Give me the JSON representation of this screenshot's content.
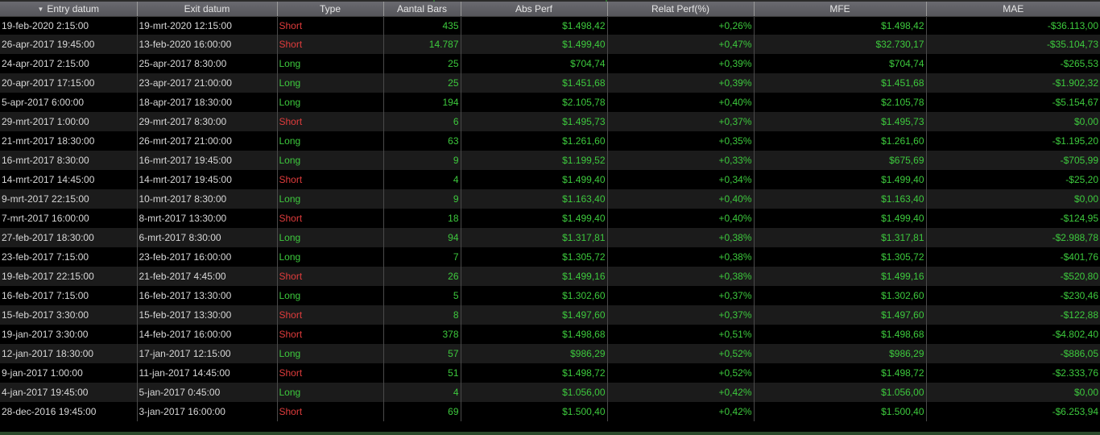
{
  "colors": {
    "header_bg": "#5f5f64",
    "row_dark": "#000000",
    "row_light": "#1b1b1b",
    "positive_green": "#3dc93d",
    "short_red": "#e03c3c",
    "text_light": "#d8d8d8"
  },
  "header": {
    "sort_icon": "sort-desc-icon",
    "columns": [
      "Entry datum",
      "Exit datum",
      "Type",
      "Aantal Bars",
      "Abs Perf",
      "Relat Perf(%)",
      "MFE",
      "MAE"
    ]
  },
  "rows": [
    {
      "entry": "19-feb-2020 2:15:00",
      "exit": "19-mrt-2020 12:15:00",
      "type": "Short",
      "bars": "435",
      "abs": "$1.498,42",
      "rel": "+0,26%",
      "mfe": "$1.498,42",
      "mae": "-$36.113,00"
    },
    {
      "entry": "26-apr-2017 19:45:00",
      "exit": "13-feb-2020 16:00:00",
      "type": "Short",
      "bars": "14.787",
      "abs": "$1.499,40",
      "rel": "+0,47%",
      "mfe": "$32.730,17",
      "mae": "-$35.104,73"
    },
    {
      "entry": "24-apr-2017 2:15:00",
      "exit": "25-apr-2017 8:30:00",
      "type": "Long",
      "bars": "25",
      "abs": "$704,74",
      "rel": "+0,39%",
      "mfe": "$704,74",
      "mae": "-$265,53"
    },
    {
      "entry": "20-apr-2017 17:15:00",
      "exit": "23-apr-2017 21:00:00",
      "type": "Long",
      "bars": "25",
      "abs": "$1.451,68",
      "rel": "+0,39%",
      "mfe": "$1.451,68",
      "mae": "-$1.902,32"
    },
    {
      "entry": "5-apr-2017 6:00:00",
      "exit": "18-apr-2017 18:30:00",
      "type": "Long",
      "bars": "194",
      "abs": "$2.105,78",
      "rel": "+0,40%",
      "mfe": "$2.105,78",
      "mae": "-$5.154,67"
    },
    {
      "entry": "29-mrt-2017 1:00:00",
      "exit": "29-mrt-2017 8:30:00",
      "type": "Short",
      "bars": "6",
      "abs": "$1.495,73",
      "rel": "+0,37%",
      "mfe": "$1.495,73",
      "mae": "$0,00"
    },
    {
      "entry": "21-mrt-2017 18:30:00",
      "exit": "26-mrt-2017 21:00:00",
      "type": "Long",
      "bars": "63",
      "abs": "$1.261,60",
      "rel": "+0,35%",
      "mfe": "$1.261,60",
      "mae": "-$1.195,20"
    },
    {
      "entry": "16-mrt-2017 8:30:00",
      "exit": "16-mrt-2017 19:45:00",
      "type": "Long",
      "bars": "9",
      "abs": "$1.199,52",
      "rel": "+0,33%",
      "mfe": "$675,69",
      "mae": "-$705,99"
    },
    {
      "entry": "14-mrt-2017 14:45:00",
      "exit": "14-mrt-2017 19:45:00",
      "type": "Short",
      "bars": "4",
      "abs": "$1.499,40",
      "rel": "+0,34%",
      "mfe": "$1.499,40",
      "mae": "-$25,20"
    },
    {
      "entry": "9-mrt-2017 22:15:00",
      "exit": "10-mrt-2017 8:30:00",
      "type": "Long",
      "bars": "9",
      "abs": "$1.163,40",
      "rel": "+0,40%",
      "mfe": "$1.163,40",
      "mae": "$0,00"
    },
    {
      "entry": "7-mrt-2017 16:00:00",
      "exit": "8-mrt-2017 13:30:00",
      "type": "Short",
      "bars": "18",
      "abs": "$1.499,40",
      "rel": "+0,40%",
      "mfe": "$1.499,40",
      "mae": "-$124,95"
    },
    {
      "entry": "27-feb-2017 18:30:00",
      "exit": "6-mrt-2017 8:30:00",
      "type": "Long",
      "bars": "94",
      "abs": "$1.317,81",
      "rel": "+0,38%",
      "mfe": "$1.317,81",
      "mae": "-$2.988,78"
    },
    {
      "entry": "23-feb-2017 7:15:00",
      "exit": "23-feb-2017 16:00:00",
      "type": "Long",
      "bars": "7",
      "abs": "$1.305,72",
      "rel": "+0,38%",
      "mfe": "$1.305,72",
      "mae": "-$401,76"
    },
    {
      "entry": "19-feb-2017 22:15:00",
      "exit": "21-feb-2017 4:45:00",
      "type": "Short",
      "bars": "26",
      "abs": "$1.499,16",
      "rel": "+0,38%",
      "mfe": "$1.499,16",
      "mae": "-$520,80"
    },
    {
      "entry": "16-feb-2017 7:15:00",
      "exit": "16-feb-2017 13:30:00",
      "type": "Long",
      "bars": "5",
      "abs": "$1.302,60",
      "rel": "+0,37%",
      "mfe": "$1.302,60",
      "mae": "-$230,46"
    },
    {
      "entry": "15-feb-2017 3:30:00",
      "exit": "15-feb-2017 13:30:00",
      "type": "Short",
      "bars": "8",
      "abs": "$1.497,60",
      "rel": "+0,37%",
      "mfe": "$1.497,60",
      "mae": "-$122,88"
    },
    {
      "entry": "19-jan-2017 3:30:00",
      "exit": "14-feb-2017 16:00:00",
      "type": "Short",
      "bars": "378",
      "abs": "$1.498,68",
      "rel": "+0,51%",
      "mfe": "$1.498,68",
      "mae": "-$4.802,40"
    },
    {
      "entry": "12-jan-2017 18:30:00",
      "exit": "17-jan-2017 12:15:00",
      "type": "Long",
      "bars": "57",
      "abs": "$986,29",
      "rel": "+0,52%",
      "mfe": "$986,29",
      "mae": "-$886,05"
    },
    {
      "entry": "9-jan-2017 1:00:00",
      "exit": "11-jan-2017 14:45:00",
      "type": "Short",
      "bars": "51",
      "abs": "$1.498,72",
      "rel": "+0,52%",
      "mfe": "$1.498,72",
      "mae": "-$2.333,76"
    },
    {
      "entry": "4-jan-2017 19:45:00",
      "exit": "5-jan-2017 0:45:00",
      "type": "Long",
      "bars": "4",
      "abs": "$1.056,00",
      "rel": "+0,42%",
      "mfe": "$1.056,00",
      "mae": "$0,00"
    },
    {
      "entry": "28-dec-2016 19:45:00",
      "exit": "3-jan-2017 16:00:00",
      "type": "Short",
      "bars": "69",
      "abs": "$1.500,40",
      "rel": "+0,42%",
      "mfe": "$1.500,40",
      "mae": "-$6.253,94"
    }
  ]
}
